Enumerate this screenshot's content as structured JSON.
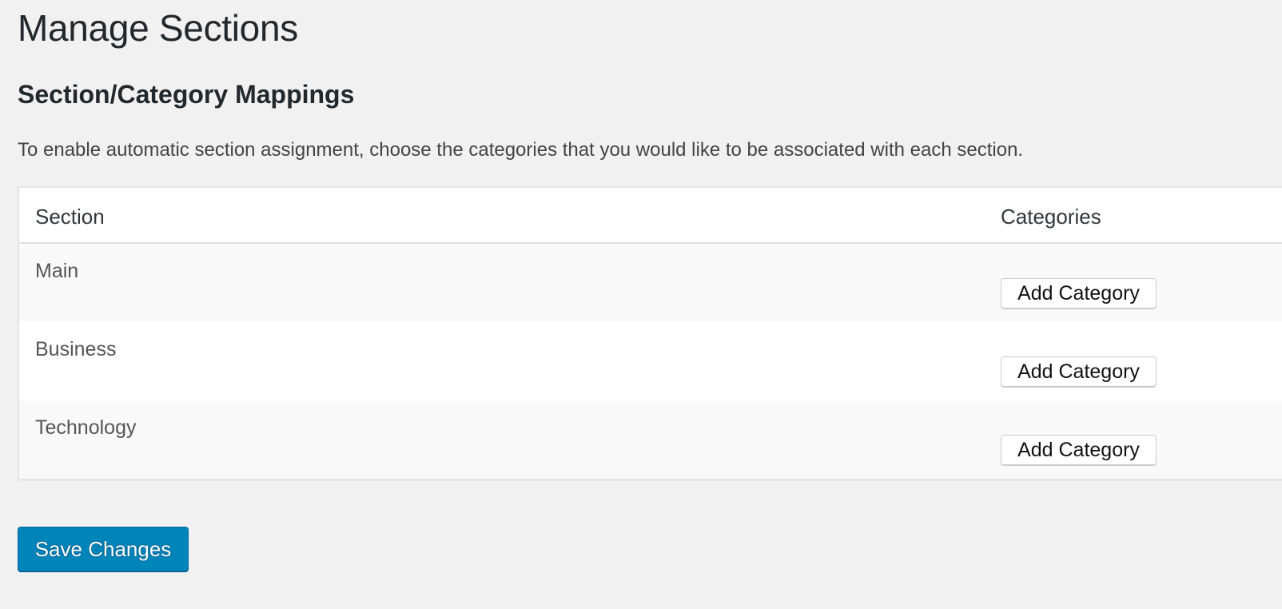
{
  "page": {
    "title": "Manage Sections",
    "subtitle": "Section/Category Mappings",
    "description": "To enable automatic section assignment, choose the categories that you would like to be associated with each section."
  },
  "table": {
    "columns": [
      "Section",
      "Categories"
    ],
    "rows": [
      {
        "section": "Main",
        "button_label": "Add Category"
      },
      {
        "section": "Business",
        "button_label": "Add Category"
      },
      {
        "section": "Technology",
        "button_label": "Add Category"
      }
    ]
  },
  "actions": {
    "save_label": "Save Changes"
  },
  "colors": {
    "background": "#f1f1f1",
    "primary_button": "#0085ba",
    "heading_text": "#23282d"
  }
}
